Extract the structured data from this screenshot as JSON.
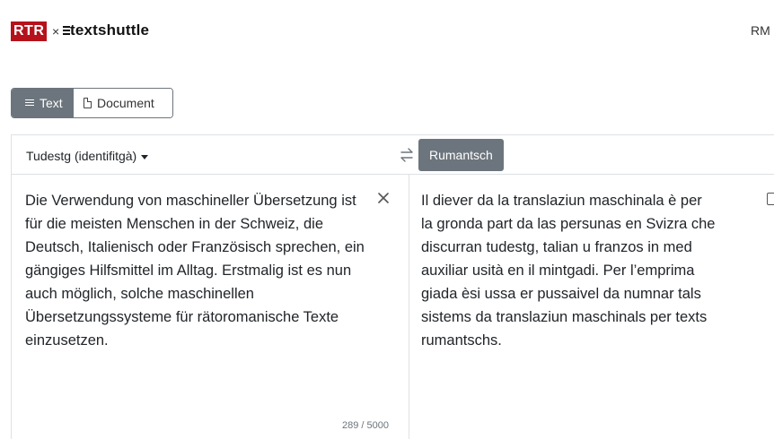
{
  "header": {
    "brand": "RTR",
    "separator": "×",
    "product": "textshuttle",
    "ui_language": "RM"
  },
  "mode": {
    "text_label": "Text",
    "document_label": "Document",
    "active": "text"
  },
  "translator": {
    "source_language": "Tudestg (identifitgà)",
    "target_language": "Rumantsch",
    "source_text": "Die Verwendung von maschineller Übersetzung ist für die meisten Menschen in der Schweiz, die Deutsch, Italienisch oder Französisch sprechen, ein gängiges Hilfsmittel im Alltag. Erstmalig ist es nun auch möglich, solche maschinellen Übersetzungssysteme für rätoromanische Texte einzusetzen.",
    "character_count": "289 / 5000",
    "target_text": "Il diever da la translaziun maschinala è per la gronda part da las persunas en Svizra che discurran tudestg, talian u franzos in med auxiliar usità en il mintgadi. Per l’emprima giada èsi ussa er pussaivel da numnar tals sistems da translaziun maschinals per texts rumantschs."
  },
  "icons": {
    "text_mode": "lines-icon",
    "document_mode": "document-icon",
    "swap": "swap-arrows-icon",
    "clear": "close-icon",
    "copy": "copy-icon"
  },
  "colors": {
    "brand_red": "#b5121b",
    "active_button": "#6c757d",
    "border": "#dee2e6"
  }
}
